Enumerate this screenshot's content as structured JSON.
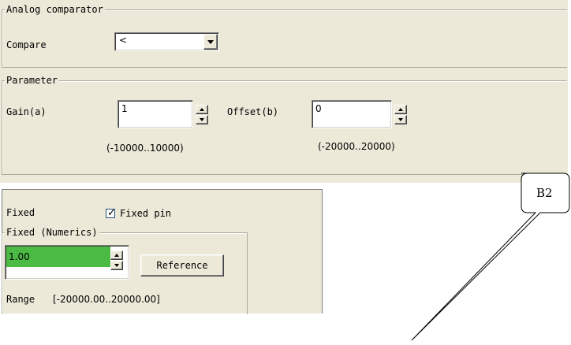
{
  "analog": {
    "group_title": "Analog comparator",
    "compare_label": "Compare",
    "compare_value": "<"
  },
  "parameter": {
    "group_title": "Parameter",
    "gain_label": "Gain(a)",
    "gain_value": "1",
    "gain_range": "(-10000..10000)",
    "offset_label": "Offset(b)",
    "offset_value": "0",
    "offset_range": "(-20000..20000)"
  },
  "fixed": {
    "label": "Fixed",
    "pin_label": "Fixed pin",
    "pin_checked": true,
    "numerics_title": "Fixed (Numerics)",
    "value": "1.00",
    "reference_label": "Reference",
    "range_label": "Range",
    "range_value": "[-20000.00..20000.00]",
    "value_color": "#4cbb44"
  },
  "callout": {
    "text": "B2"
  }
}
